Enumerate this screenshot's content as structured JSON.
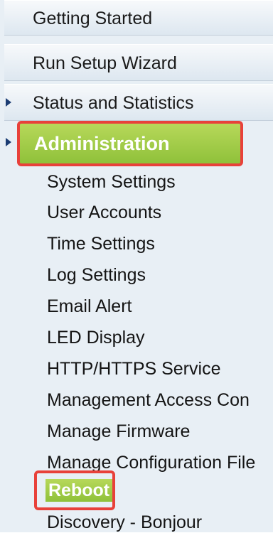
{
  "nav": {
    "top_items": [
      {
        "label": "Getting Started"
      },
      {
        "label": "Run Setup Wizard"
      },
      {
        "label": "Status and Statistics"
      }
    ],
    "admin": {
      "label": "Administration",
      "sub_items": [
        {
          "label": "System Settings"
        },
        {
          "label": "User Accounts"
        },
        {
          "label": "Time Settings"
        },
        {
          "label": "Log Settings"
        },
        {
          "label": "Email Alert"
        },
        {
          "label": "LED Display"
        },
        {
          "label": "HTTP/HTTPS Service"
        },
        {
          "label": "Management Access Con"
        },
        {
          "label": "Manage Firmware"
        },
        {
          "label": "Manage Configuration File"
        },
        {
          "label": "Reboot"
        },
        {
          "label": "Discovery - Bonjour"
        }
      ]
    }
  },
  "colors": {
    "highlight": "#e8413a",
    "active_green": "#9ccb3f",
    "arrow": "#1b3c73"
  }
}
